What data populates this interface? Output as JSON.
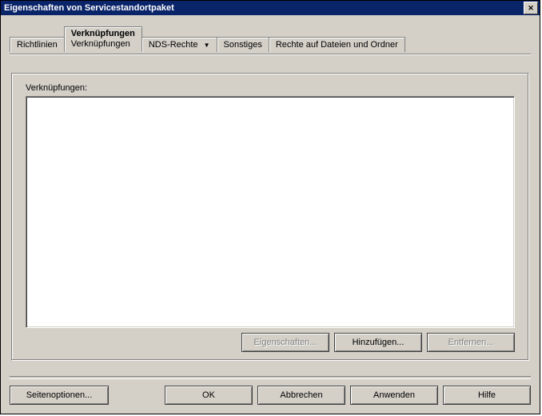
{
  "window": {
    "title": "Eigenschaften von Servicestandortpaket"
  },
  "tabs": {
    "t0": "Richtlinien",
    "t1_main": "Verknüpfungen",
    "t1_sub": "Verknüpfungen",
    "t2": "NDS-Rechte",
    "t3": "Sonstiges",
    "t4": "Rechte auf Dateien und Ordner"
  },
  "labels": {
    "list_caption": "Verknüpfungen:"
  },
  "buttons": {
    "properties": "Eigenschaften...",
    "add": "Hinzufügen...",
    "remove": "Entfernen...",
    "page_options": "Seitenoptionen...",
    "ok": "OK",
    "cancel": "Abbrechen",
    "apply": "Anwenden",
    "help": "Hilfe"
  }
}
